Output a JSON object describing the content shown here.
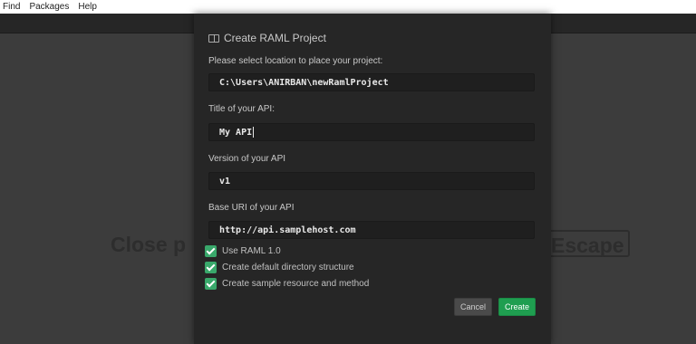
{
  "menu": {
    "items": [
      "Find",
      "Packages",
      "Help"
    ]
  },
  "background": {
    "text": "Close p",
    "key": "Escape"
  },
  "dialog": {
    "title": "Create RAML Project",
    "title_icon": "book-icon",
    "fields": {
      "location": {
        "label": "Please select location to place your project:",
        "value": "C:\\Users\\ANIRBAN\\newRamlProject"
      },
      "title": {
        "label": "Title of your API:",
        "value": "My API"
      },
      "version": {
        "label": "Version of your API",
        "value": "v1"
      },
      "base_uri": {
        "label": "Base URI of your API",
        "value": "http://api.samplehost.com"
      }
    },
    "options": [
      {
        "label": "Use RAML 1.0",
        "checked": true
      },
      {
        "label": "Create default directory structure",
        "checked": true
      },
      {
        "label": "Create sample resource and method",
        "checked": true
      }
    ],
    "buttons": {
      "cancel": "Cancel",
      "create": "Create"
    }
  },
  "colors": {
    "accent": "#1f9e50",
    "checkbox": "#39a86b",
    "dialog_bg": "#262626",
    "field_bg": "#1f1f1f"
  }
}
